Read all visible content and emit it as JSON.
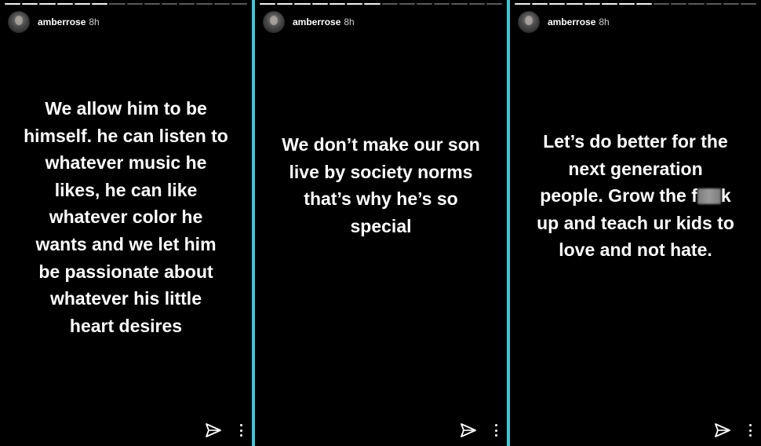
{
  "stories": [
    {
      "username": "amberrose",
      "time": "8h",
      "lines": [
        "We allow him to be",
        "himself. he can listen to",
        "whatever music he",
        "likes, he can like",
        "whatever color he",
        "wants and we let him",
        "be passionate about",
        "whatever his little",
        "heart desires"
      ]
    },
    {
      "username": "amberrose",
      "time": "8h",
      "lines": [
        "We don’t make our son",
        "live by society norms",
        "that’s why he’s so",
        "special"
      ]
    },
    {
      "username": "amberrose",
      "time": "8h",
      "lines": [
        "Let’s do better for the",
        "next generation",
        "people. Grow the f",
        "k",
        "up and teach ur kids to",
        "love and not hate."
      ]
    }
  ],
  "icons": {
    "send": "paper-plane-icon",
    "more": "vertical-ellipsis-icon"
  },
  "colors": {
    "background": "#000000",
    "divider": "#3ec6d4",
    "text": "#ffffff"
  }
}
